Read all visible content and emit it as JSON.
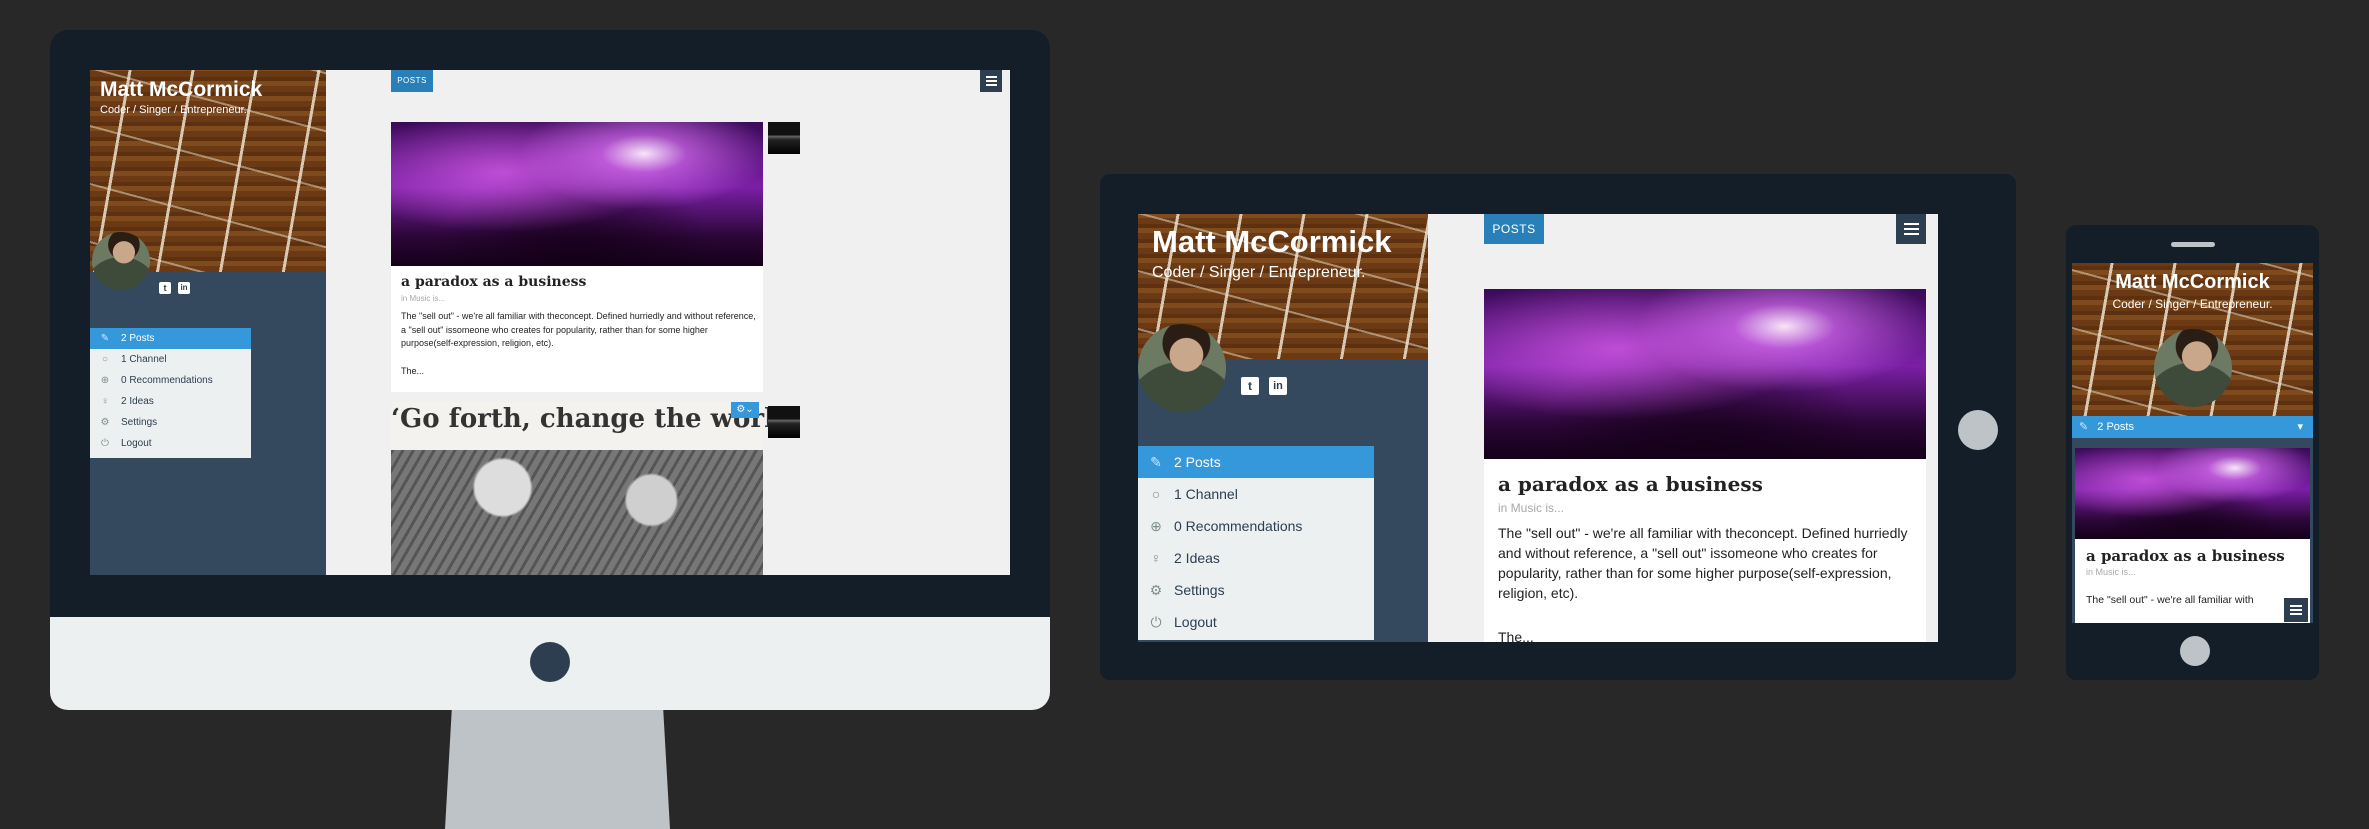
{
  "profile": {
    "name": "Matt McCormick",
    "tagline": "Coder / Singer / Entrepreneur."
  },
  "menu": [
    {
      "label": "2 Posts",
      "icon": "pencil-icon",
      "glyph": "✎",
      "active": true
    },
    {
      "label": "1 Channel",
      "icon": "circle-icon",
      "glyph": "○",
      "active": false
    },
    {
      "label": "0 Recommendations",
      "icon": "plus-circle-icon",
      "glyph": "⊕",
      "active": false
    },
    {
      "label": "2 Ideas",
      "icon": "lightbulb-icon",
      "glyph": "♀",
      "active": false
    },
    {
      "label": "Settings",
      "icon": "gear-icon",
      "glyph": "⚙",
      "active": false
    },
    {
      "label": "Logout",
      "icon": "power-icon",
      "glyph": "⏻",
      "active": false
    }
  ],
  "social": {
    "twitter": "t",
    "linkedin": "in"
  },
  "tag_label": "POSTS",
  "post1": {
    "title": "a paradox as a business",
    "meta": "in Music is...",
    "excerpt": "The \"sell out\" - we're all familiar with theconcept. Defined hurriedly and without reference, a \"sell out\" issomeone who creates for popularity, rather than for some higher purpose(self-expression, religion, etc).",
    "more": "The..."
  },
  "post2": {
    "title": "‘Go forth, change the world"
  },
  "mobile": {
    "active_menu": "2 Posts",
    "excerpt_start": "The \"sell out\" - we're all familiar with"
  },
  "colors": {
    "page_bg": "#282828",
    "device_frame": "#141e28",
    "sidebar": "#34495e",
    "accent": "#3498db",
    "content_bg": "#f0f0f0"
  }
}
